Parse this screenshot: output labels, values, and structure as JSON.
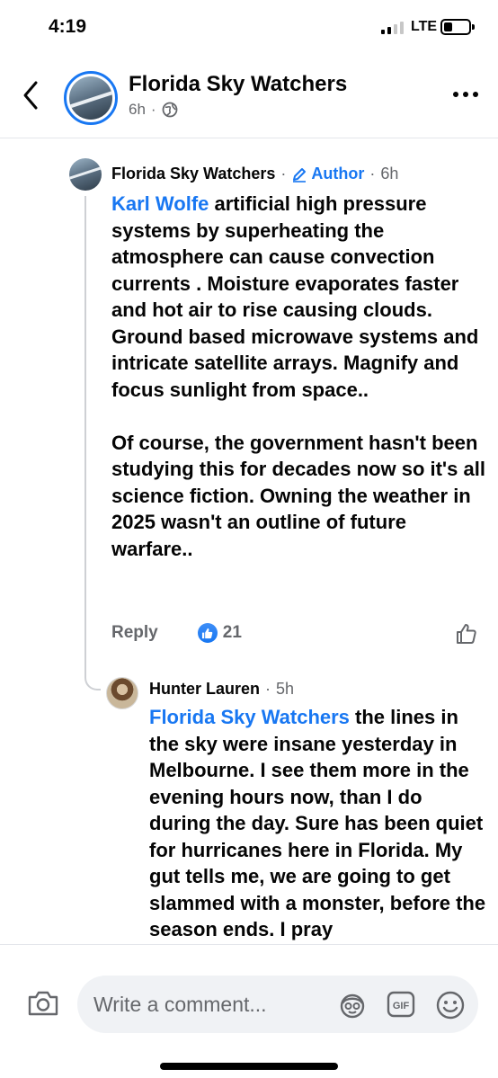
{
  "status_bar": {
    "time": "4:19",
    "network": "LTE"
  },
  "header": {
    "title": "Florida Sky Watchers",
    "time": "6h",
    "dot": "·",
    "back_icon": "chevron-left-icon",
    "audience_icon": "globe-icon",
    "more_icon": "more-dots-icon"
  },
  "comments": [
    {
      "author": "Florida Sky Watchers",
      "badge": "Author",
      "time": "6h",
      "mention": "Karl Wolfe",
      "paragraphs": [
        " artificial high pressure systems by superheating the atmosphere can cause convection currents . Moisture evaporates faster and hot air to rise causing clouds. Ground based microwave systems and intricate satellite arrays. Magnify and focus sunlight from space..",
        "Of course, the government hasn't been studying this for decades now so it's all science fiction. Owning the weather in 2025 wasn't an outline of future warfare.."
      ],
      "reply_label": "Reply",
      "reaction_count": "21"
    },
    {
      "author": "Hunter Lauren",
      "time": "5h",
      "mention": "Florida Sky Watchers",
      "text": " the lines in the sky were insane yesterday in Melbourne. I see them more in the evening hours now, than I do during the day. Sure has been quiet for hurricanes here in Florida. My gut tells me, we are going to get slammed with a monster, before the season ends. I pray"
    }
  ],
  "composer": {
    "placeholder": "Write a comment...",
    "gif_label": "GIF"
  },
  "colors": {
    "accent": "#1877f2",
    "secondary_text": "#65676b",
    "input_bg": "#f0f2f5"
  }
}
